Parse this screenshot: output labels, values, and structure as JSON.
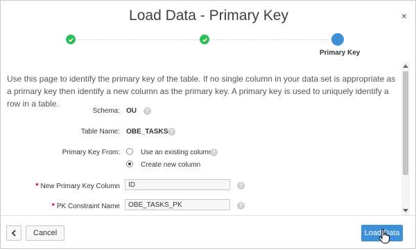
{
  "dialog": {
    "title": "Load Data - Primary Key",
    "close_label": "×"
  },
  "wizard": {
    "steps": [
      {
        "state": "complete",
        "label": ""
      },
      {
        "state": "complete",
        "label": ""
      },
      {
        "state": "current",
        "label": "Primary Key"
      }
    ],
    "complete_color": "#2ebd59",
    "current_color": "#3d8fd8"
  },
  "intro_text": "Use this page to identify the primary key of the table. If no single column in your data set is appropriate as a primary key then identify a new column as the primary key. A primary key is used to uniquely identify a row in a table.",
  "form": {
    "schema": {
      "label": "Schema:",
      "value": "OU"
    },
    "table_name": {
      "label": "Table Name:",
      "value": "OBE_TASKS"
    },
    "primary_key_from": {
      "label": "Primary Key From:",
      "options": [
        {
          "label": "Use an existing column",
          "selected": false
        },
        {
          "label": "Create new column",
          "selected": true
        }
      ]
    },
    "new_pk_column": {
      "label": "New Primary Key Column",
      "value": "ID",
      "required": true
    },
    "pk_constraint": {
      "label": "PK Constraint Name",
      "value": "OBE_TASKS_PK",
      "required": true
    },
    "help_glyph": "?",
    "required_marker": "*"
  },
  "footer": {
    "back_icon": "chevron-left-icon",
    "cancel_label": "Cancel",
    "load_label": "Load Data"
  }
}
